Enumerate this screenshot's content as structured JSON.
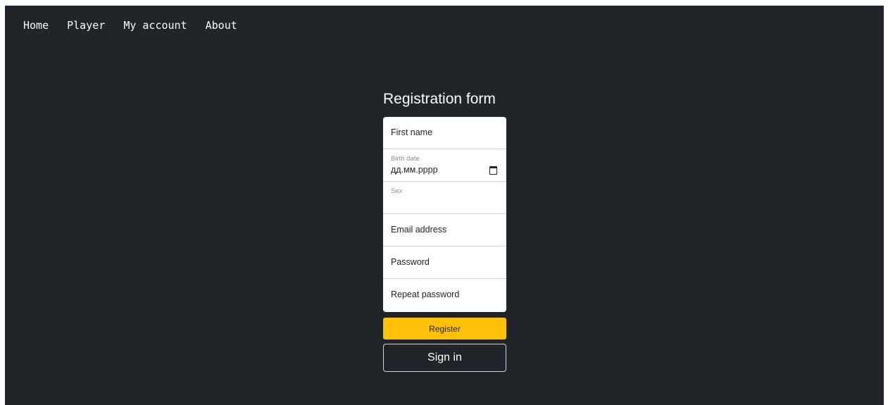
{
  "nav": {
    "items": [
      {
        "label": "Home"
      },
      {
        "label": "Player"
      },
      {
        "label": "My account"
      },
      {
        "label": "About"
      }
    ]
  },
  "form": {
    "title": "Registration form",
    "first_name_placeholder": "First name",
    "birth_date_label": "Birth date",
    "birth_date_value": "дд.мм.рррр",
    "sex_label": "Sex",
    "sex_value": "",
    "email_placeholder": "Email address",
    "password_placeholder": "Password",
    "repeat_password_placeholder": "Repeat password",
    "register_label": "Register",
    "signin_label": "Sign in"
  },
  "icons": {
    "date_picker": "calendar-icon"
  },
  "colors": {
    "background": "#212529",
    "accent": "#ffc107"
  }
}
